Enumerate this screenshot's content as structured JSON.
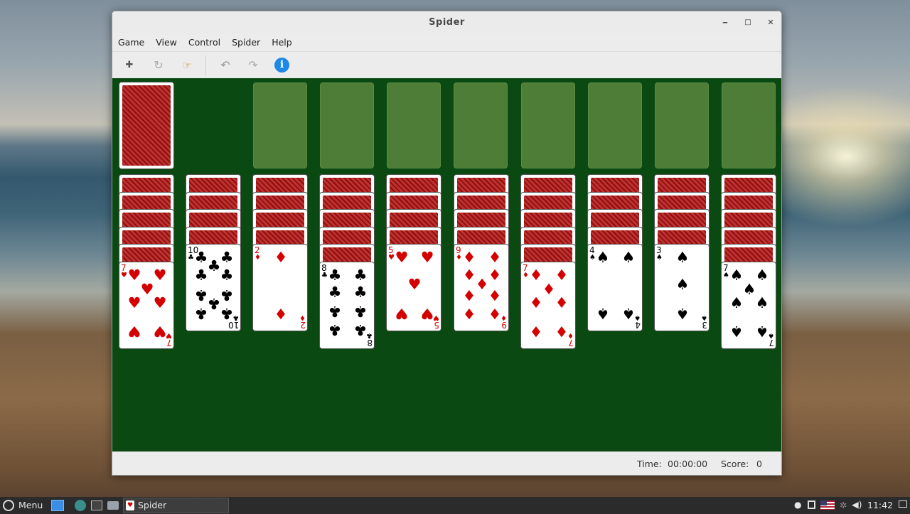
{
  "window": {
    "title": "Spider",
    "minimize": "‒",
    "maximize": "□",
    "close": "✕"
  },
  "menubar": [
    "Game",
    "View",
    "Control",
    "Spider",
    "Help"
  ],
  "toolbar": [
    {
      "name": "new-game-icon",
      "glyph": "✚"
    },
    {
      "name": "restart-icon",
      "glyph": "↻"
    },
    {
      "name": "hint-icon",
      "glyph": "☞"
    },
    {
      "name": "undo-icon",
      "glyph": "↶"
    },
    {
      "name": "redo-icon",
      "glyph": "↷"
    },
    {
      "name": "info-icon",
      "glyph": "i"
    }
  ],
  "colors": {
    "felt": "#0a4a12",
    "slot": "#4e7d37",
    "red": "#d40000",
    "info": "#1e88e5"
  },
  "foundations": 8,
  "tableau": [
    {
      "backs": 5,
      "face": {
        "rank": "7",
        "suit": "♥",
        "color": "red"
      }
    },
    {
      "backs": 4,
      "face": {
        "rank": "10",
        "suit": "♣",
        "color": "blk"
      }
    },
    {
      "backs": 4,
      "face": {
        "rank": "2",
        "suit": "♦",
        "color": "red"
      }
    },
    {
      "backs": 5,
      "face": {
        "rank": "8",
        "suit": "♣",
        "color": "blk"
      }
    },
    {
      "backs": 4,
      "face": {
        "rank": "5",
        "suit": "♥",
        "color": "red"
      }
    },
    {
      "backs": 4,
      "face": {
        "rank": "9",
        "suit": "♦",
        "color": "red"
      }
    },
    {
      "backs": 5,
      "face": {
        "rank": "7",
        "suit": "♦",
        "color": "red"
      }
    },
    {
      "backs": 4,
      "face": {
        "rank": "4",
        "suit": "♠",
        "color": "blk"
      }
    },
    {
      "backs": 4,
      "face": {
        "rank": "3",
        "suit": "♠",
        "color": "blk"
      }
    },
    {
      "backs": 5,
      "face": {
        "rank": "7",
        "suit": "♠",
        "color": "blk"
      }
    }
  ],
  "status": {
    "time_label": "Time:",
    "time_value": "00:00:00",
    "score_label": "Score:",
    "score_value": "0"
  },
  "taskbar": {
    "menu_label": "Menu",
    "app_label": "Spider",
    "clock": "11:42"
  }
}
